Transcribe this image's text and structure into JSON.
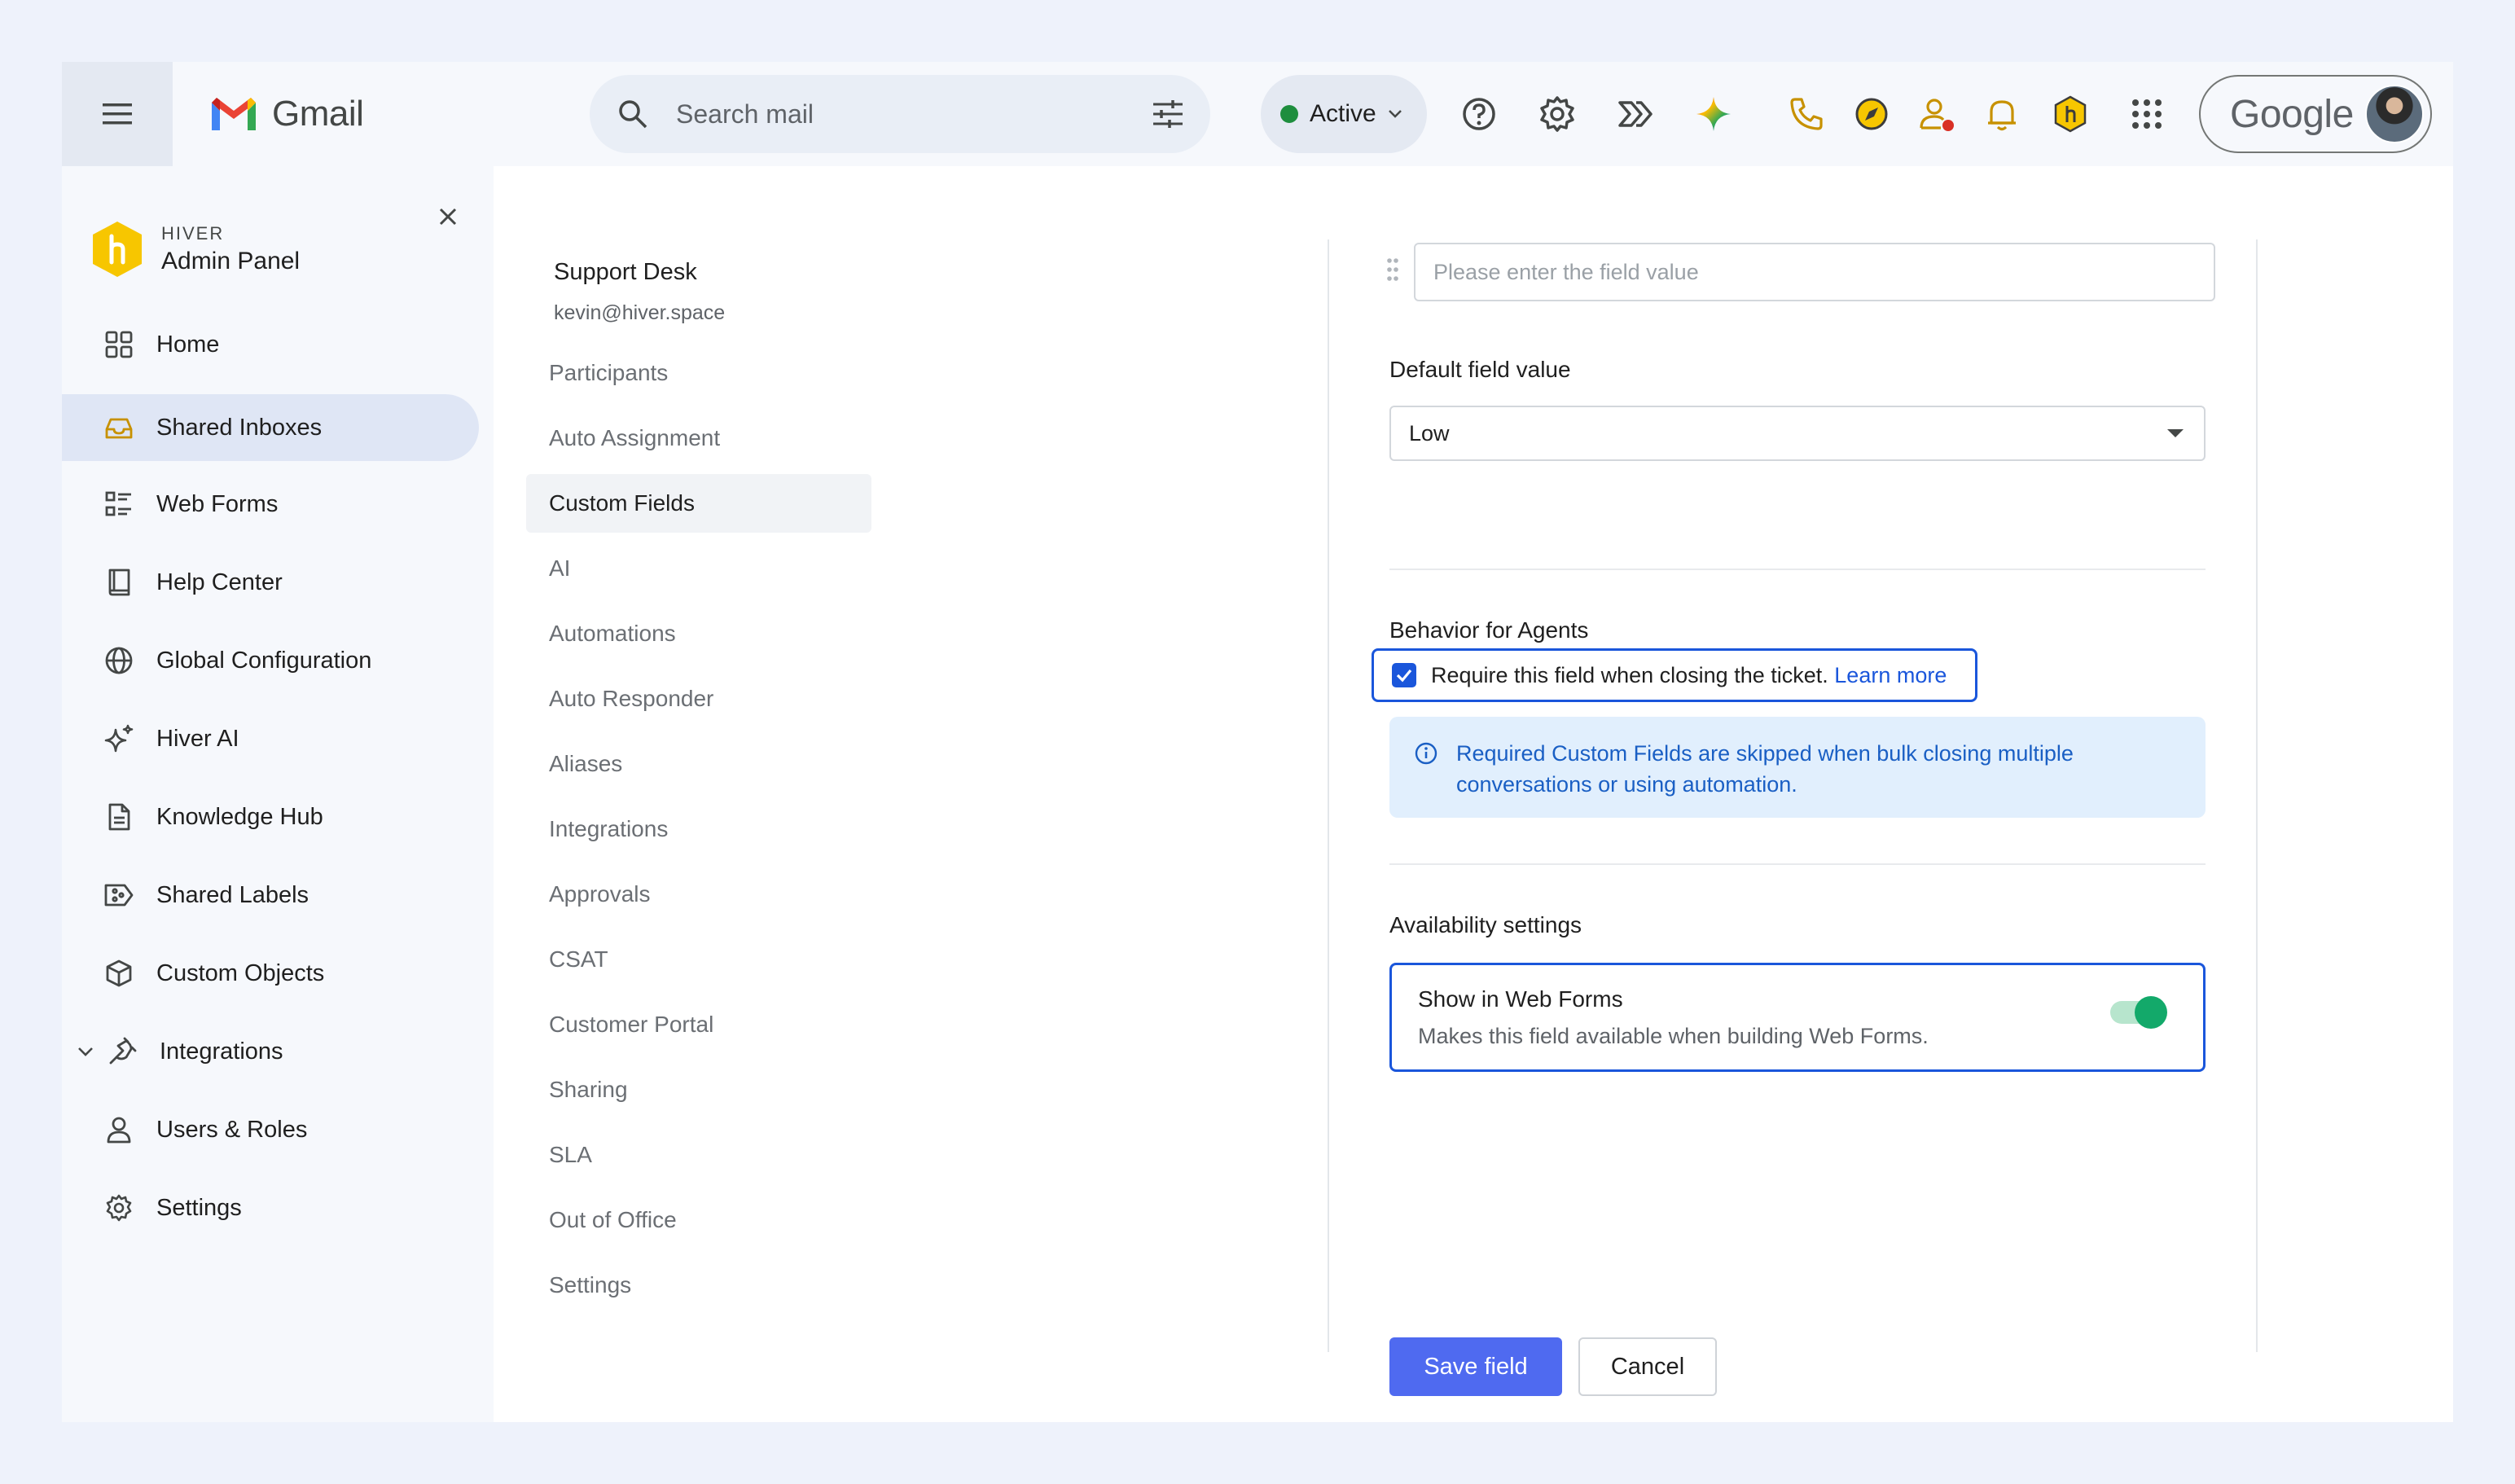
{
  "topbar": {
    "app_name": "Gmail",
    "search_placeholder": "Search mail",
    "status_label": "Active",
    "status_color": "#1e8e3e",
    "account_brand": "Google",
    "icons": [
      "menu-icon",
      "search-icon",
      "filter-options-icon",
      "chevron-down-icon",
      "help-icon",
      "settings-icon",
      "hiver-flows-icon",
      "gemini-icon",
      "phone-icon",
      "compass-icon",
      "contact-alert-icon",
      "bell-icon",
      "hiver-icon",
      "apps-grid-icon"
    ]
  },
  "sidebar": {
    "brand_small": "HIVER",
    "brand_title": "Admin Panel",
    "items": [
      {
        "label": "Home",
        "icon": "grid-icon"
      },
      {
        "label": "Shared Inboxes",
        "icon": "inbox-icon",
        "selected": true
      },
      {
        "label": "Web Forms",
        "icon": "form-icon"
      },
      {
        "label": "Help Center",
        "icon": "book-icon"
      },
      {
        "label": "Global Configuration",
        "icon": "globe-icon"
      },
      {
        "label": "Hiver AI",
        "icon": "sparkle-icon"
      },
      {
        "label": "Knowledge Hub",
        "icon": "document-icon"
      },
      {
        "label": "Shared Labels",
        "icon": "label-share-icon"
      },
      {
        "label": "Custom Objects",
        "icon": "cube-icon"
      },
      {
        "label": "Integrations",
        "icon": "plug-icon"
      },
      {
        "label": "Users & Roles",
        "icon": "user-icon"
      },
      {
        "label": "Settings",
        "icon": "gear-icon"
      }
    ]
  },
  "subnav": {
    "title": "Support Desk",
    "email": "kevin@hiver.space",
    "items": [
      "Participants",
      "Auto Assignment",
      "Custom Fields",
      "AI",
      "Automations",
      "Auto Responder",
      "Aliases",
      "Integrations",
      "Approvals",
      "CSAT",
      "Customer Portal",
      "Sharing",
      "SLA",
      "Out of Office",
      "Settings"
    ],
    "selected": "Custom Fields"
  },
  "form": {
    "field_value_placeholder": "Please enter the field value",
    "default_label": "Default field value",
    "default_value": "Low",
    "behavior_label": "Behavior for Agents",
    "require_text": "Require this field when closing the ticket.",
    "require_link": "Learn more",
    "require_checked": true,
    "info_text": "Required Custom Fields are skipped when bulk closing multiple conversations or using automation.",
    "availability_label": "Availability settings",
    "web_forms_title": "Show in Web Forms",
    "web_forms_sub": "Makes this field available when building Web Forms.",
    "web_forms_enabled": true,
    "save_label": "Save field",
    "cancel_label": "Cancel",
    "accent_color": "#4f6af0"
  }
}
